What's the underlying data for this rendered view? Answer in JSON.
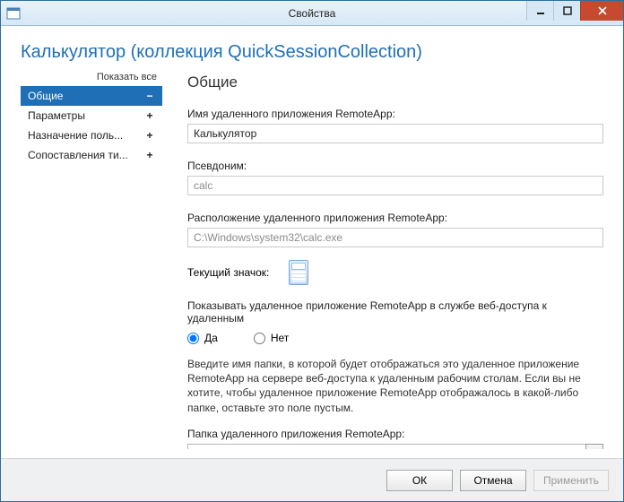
{
  "window": {
    "title": "Свойства"
  },
  "page_title": "Калькулятор (коллекция QuickSessionCollection)",
  "sidebar": {
    "show_all": "Показать все",
    "items": [
      {
        "label": "Общие",
        "sign": "−",
        "active": true
      },
      {
        "label": "Параметры",
        "sign": "+",
        "active": false
      },
      {
        "label": "Назначение поль...",
        "sign": "+",
        "active": false
      },
      {
        "label": "Сопоставления ти...",
        "sign": "+",
        "active": false
      }
    ]
  },
  "main": {
    "heading": "Общие",
    "name_label": "Имя удаленного приложения RemoteApp:",
    "name_value": "Калькулятор",
    "alias_label": "Псевдоним:",
    "alias_value": "calc",
    "location_label": "Расположение удаленного приложения RemoteApp:",
    "location_value": "C:\\Windows\\system32\\calc.exe",
    "icon_label": "Текущий значок:",
    "show_label": "Показывать удаленное приложение RemoteApp в службе веб-доступа к удаленным",
    "radio_yes": "Да",
    "radio_no": "Нет",
    "help_text": "Введите имя папки, в которой будет отображаться это удаленное приложение RemoteApp на сервере веб-доступа к удаленным рабочим столам. Если вы не хотите, чтобы удаленное приложение RemoteApp отображалось в какой-либо папке, оставьте это поле пустым.",
    "folder_label": "Папка удаленного приложения RemoteApp:",
    "folder_value": ""
  },
  "footer": {
    "ok": "ОК",
    "cancel": "Отмена",
    "apply": "Применить"
  }
}
